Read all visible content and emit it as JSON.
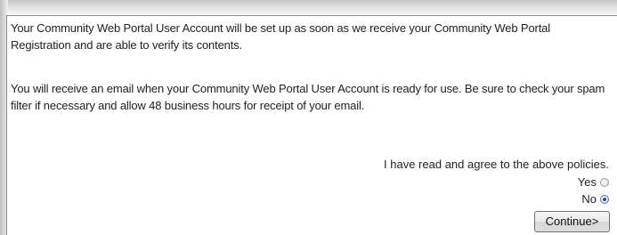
{
  "notice": {
    "paragraph1": "Your Community Web Portal User Account will be set up as soon as we receive your Community Web Portal Registration and are able to verify its contents.",
    "paragraph2": "You will receive an email when your Community Web Portal User Account is ready for use. Be sure to check your spam filter if necessary and allow 48 business hours for receipt of your email."
  },
  "agreement": {
    "prompt": "I have read and agree to the above policies.",
    "options": [
      {
        "label": "Yes",
        "selected": false
      },
      {
        "label": "No",
        "selected": true
      }
    ]
  },
  "actions": {
    "continue_label": "Continue>"
  }
}
